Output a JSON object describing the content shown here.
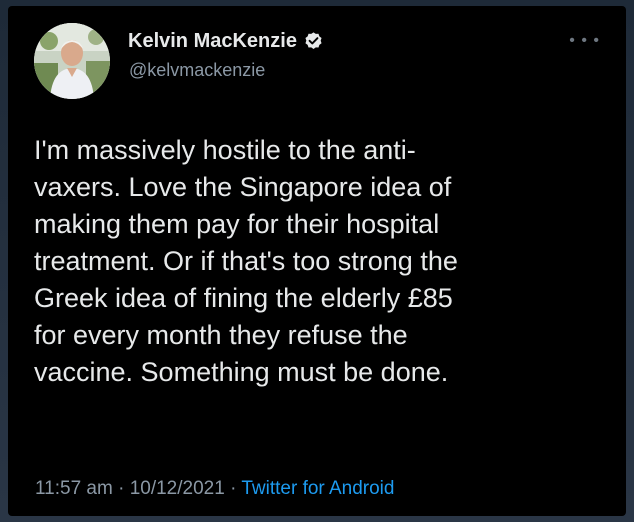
{
  "author": {
    "display_name": "Kelvin MacKenzie",
    "handle": "@kelvmackenzie",
    "verified": true,
    "avatar_icon": "profile-photo"
  },
  "menu_icon": "more-options-icon",
  "tweet": {
    "lines": [
      "I'm massively hostile to the anti-",
      "vaxers. Love the Singapore idea of",
      "making them pay for their hospital",
      "treatment. Or if that's too strong the",
      "Greek idea of fining the elderly £85",
      "for every month they refuse the",
      "vaccine. Something must be done."
    ]
  },
  "meta": {
    "time": "11:57 am",
    "date": "10/12/2021",
    "separator": "·",
    "source": "Twitter for Android"
  },
  "colors": {
    "background": "#000000",
    "text": "#e7e9ea",
    "secondary": "#8b98a5",
    "link": "#1d9bf0"
  }
}
